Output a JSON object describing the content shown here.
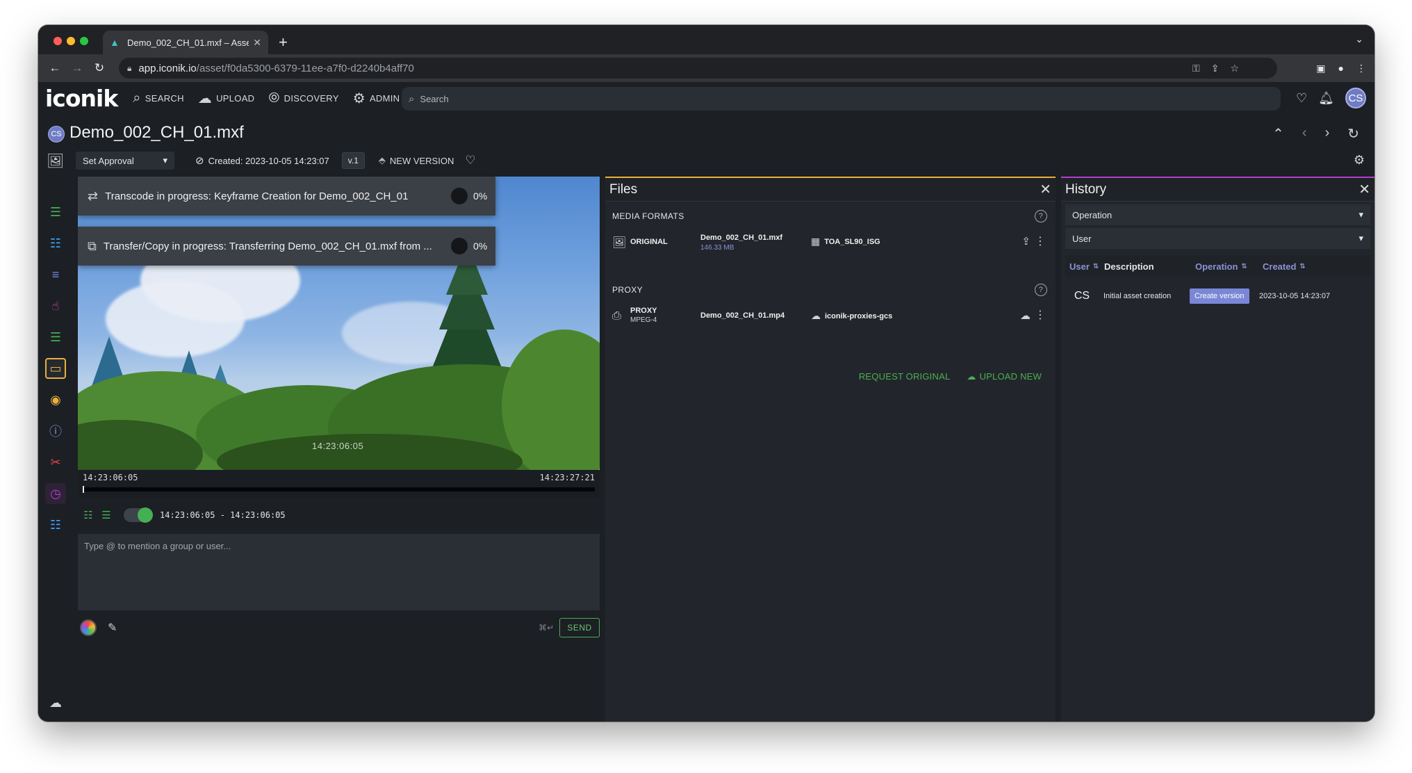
{
  "browser": {
    "tab_title": "Demo_002_CH_01.mxf – Asse",
    "url_host": "app.iconik.io",
    "url_path": "/asset/f0da5300-6379-11ee-a7f0-d2240b4aff70"
  },
  "app": {
    "logo": "iconik",
    "nav": [
      {
        "label": "SEARCH",
        "icon": "search-icon"
      },
      {
        "label": "UPLOAD",
        "icon": "upload-cloud-icon"
      },
      {
        "label": "DISCOVERY",
        "icon": "compass-icon"
      },
      {
        "label": "ADMIN",
        "icon": "gear-icon"
      }
    ],
    "search_placeholder": "Search",
    "user_initials": "CS"
  },
  "asset": {
    "owner_initials": "CS",
    "title": "Demo_002_CH_01.mxf",
    "approval": "Set Approval",
    "created": "Created: 2023-10-05 14:23:07",
    "version": "v.1",
    "new_version": "NEW VERSION"
  },
  "toasts": [
    {
      "message": "Transcode in progress: Keyframe Creation for Demo_002_CH_01",
      "percent": "0%"
    },
    {
      "message": "Transfer/Copy in progress: Transferring Demo_002_CH_01.mxf from ...",
      "percent": "0%"
    }
  ],
  "player": {
    "overlay_timecode": "14:23:06:05",
    "start_tc": "14:23:06:05",
    "end_tc": "14:23:27:21",
    "range": "14:23:06:05 - 14:23:06:05",
    "comment_placeholder": "Type @ to mention a group or user...",
    "shortcut": "⌘↵",
    "send": "SEND"
  },
  "files": {
    "title": "Files",
    "media_formats_label": "MEDIA FORMATS",
    "original": {
      "type": "ORIGINAL",
      "name": "Demo_002_CH_01.mxf",
      "size": "146.33 MB",
      "storage": "TOA_SL90_ISG"
    },
    "proxy_label": "PROXY",
    "proxy": {
      "type": "PROXY",
      "format": "MPEG-4",
      "name": "Demo_002_CH_01.mp4",
      "storage": "iconik-proxies-gcs"
    },
    "request_original": "REQUEST ORIGINAL",
    "upload_new": "UPLOAD NEW"
  },
  "history": {
    "title": "History",
    "filter_operation": "Operation",
    "filter_user": "User",
    "columns": {
      "user": "User",
      "description": "Description",
      "operation": "Operation",
      "created": "Created"
    },
    "rows": [
      {
        "user": "CS",
        "description": "Initial asset creation",
        "operation": "Create version",
        "created": "2023-10-05 14:23:07"
      }
    ]
  },
  "colors": {
    "accent_files": "#e8b13a",
    "accent_history": "#b03fcf",
    "accent_green": "#4caf50",
    "accent_indigo": "#7a86d6"
  }
}
